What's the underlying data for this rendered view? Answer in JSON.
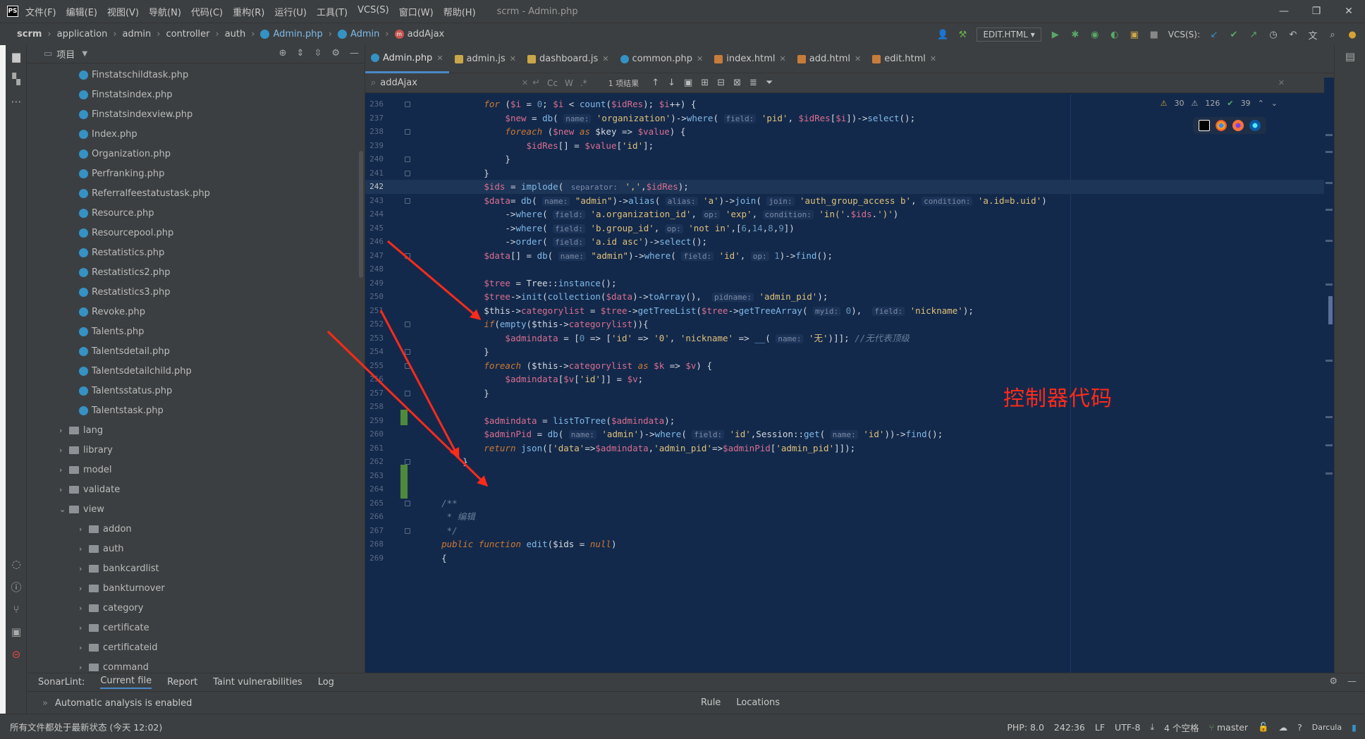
{
  "window": {
    "app_logo": "PS",
    "title": "scrm - Admin.php",
    "menu": [
      "文件(F)",
      "编辑(E)",
      "视图(V)",
      "导航(N)",
      "代码(C)",
      "重构(R)",
      "运行(U)",
      "工具(T)",
      "VCS(S)",
      "窗口(W)",
      "帮助(H)"
    ],
    "controls": [
      "—",
      "❐",
      "✕"
    ]
  },
  "breadcrumb": [
    "scrm",
    "application",
    "admin",
    "controller",
    "auth",
    "Admin.php",
    "Admin",
    "addAjax"
  ],
  "toolbar": {
    "run_config": "EDIT.HTML",
    "vcs_label": "VCS(S):"
  },
  "project_panel": {
    "title": "项目",
    "tree": [
      {
        "type": "file",
        "label": "Finstatschildtask.php",
        "indent": 3
      },
      {
        "type": "file",
        "label": "Finstatsindex.php",
        "indent": 3
      },
      {
        "type": "file",
        "label": "Finstatsindexview.php",
        "indent": 3
      },
      {
        "type": "file",
        "label": "Index.php",
        "indent": 3
      },
      {
        "type": "file",
        "label": "Organization.php",
        "indent": 3
      },
      {
        "type": "file",
        "label": "Perfranking.php",
        "indent": 3
      },
      {
        "type": "file",
        "label": "Referralfeestatustask.php",
        "indent": 3
      },
      {
        "type": "file",
        "label": "Resource.php",
        "indent": 3
      },
      {
        "type": "file",
        "label": "Resourcepool.php",
        "indent": 3
      },
      {
        "type": "file",
        "label": "Restatistics.php",
        "indent": 3
      },
      {
        "type": "file",
        "label": "Restatistics2.php",
        "indent": 3
      },
      {
        "type": "file",
        "label": "Restatistics3.php",
        "indent": 3
      },
      {
        "type": "file",
        "label": "Revoke.php",
        "indent": 3
      },
      {
        "type": "file",
        "label": "Talents.php",
        "indent": 3
      },
      {
        "type": "file",
        "label": "Talentsdetail.php",
        "indent": 3
      },
      {
        "type": "file",
        "label": "Talentsdetailchild.php",
        "indent": 3
      },
      {
        "type": "file",
        "label": "Talentsstatus.php",
        "indent": 3
      },
      {
        "type": "file",
        "label": "Talentstask.php",
        "indent": 3
      },
      {
        "type": "folder",
        "label": "lang",
        "indent": 2,
        "open": false
      },
      {
        "type": "folder",
        "label": "library",
        "indent": 2,
        "open": false
      },
      {
        "type": "folder",
        "label": "model",
        "indent": 2,
        "open": false
      },
      {
        "type": "folder",
        "label": "validate",
        "indent": 2,
        "open": false
      },
      {
        "type": "folder",
        "label": "view",
        "indent": 2,
        "open": true
      },
      {
        "type": "folder",
        "label": "addon",
        "indent": 3,
        "open": false
      },
      {
        "type": "folder",
        "label": "auth",
        "indent": 3,
        "open": false
      },
      {
        "type": "folder",
        "label": "bankcardlist",
        "indent": 3,
        "open": false
      },
      {
        "type": "folder",
        "label": "bankturnover",
        "indent": 3,
        "open": false
      },
      {
        "type": "folder",
        "label": "category",
        "indent": 3,
        "open": false
      },
      {
        "type": "folder",
        "label": "certificate",
        "indent": 3,
        "open": false
      },
      {
        "type": "folder",
        "label": "certificateid",
        "indent": 3,
        "open": false
      },
      {
        "type": "folder",
        "label": "command",
        "indent": 3,
        "open": false
      }
    ]
  },
  "tabs": [
    {
      "label": "Admin.php",
      "kind": "php",
      "active": true
    },
    {
      "label": "admin.js",
      "kind": "js",
      "active": false
    },
    {
      "label": "dashboard.js",
      "kind": "js",
      "active": false
    },
    {
      "label": "common.php",
      "kind": "php",
      "active": false
    },
    {
      "label": "index.html",
      "kind": "html",
      "active": false
    },
    {
      "label": "add.html",
      "kind": "html",
      "active": false
    },
    {
      "label": "edit.html",
      "kind": "html",
      "active": false
    }
  ],
  "find": {
    "query": "addAjax",
    "options": [
      "Cc",
      "W",
      ".*"
    ],
    "result": "1 项结果"
  },
  "inspections": {
    "warnings": "30",
    "weak": "126",
    "ok": "39"
  },
  "current_line": 242,
  "code_lines": [
    {
      "n": 236,
      "html": "            <span class='k'>for</span> (<span class='v'>$i</span> = <span class='n'>0</span>; <span class='v'>$i</span> &lt; <span class='f'>count</span>(<span class='v'>$idRes</span>); <span class='v'>$i</span>++) {"
    },
    {
      "n": 237,
      "html": "                <span class='v'>$new</span> = <span class='f'>db</span>( <span class='h'>name:</span> <span class='s'>'organization'</span>)-&gt;<span class='f'>where</span>( <span class='h'>field:</span> <span class='s'>'pid'</span>, <span class='v'>$idRes</span>[<span class='v'>$i</span>])-&gt;<span class='f'>select</span>();"
    },
    {
      "n": 238,
      "html": "                <span class='k'>foreach</span> (<span class='v'>$new</span> <span class='k'>as</span> $key =&gt; <span class='v'>$value</span>) {"
    },
    {
      "n": 239,
      "html": "                    <span class='v'>$idRes</span>[] = <span class='v'>$value</span>[<span class='s'>'id'</span>];"
    },
    {
      "n": 240,
      "html": "                }"
    },
    {
      "n": 241,
      "html": "            }"
    },
    {
      "n": 242,
      "html": "            <span class='v'>$ids</span> = <span class='f'>implode</span>( <span class='h'>separator:</span> <span class='s'>','</span>,<span class='v'>$idRes</span>);"
    },
    {
      "n": 243,
      "html": "            <span class='v'>$data</span>= <span class='f'>db</span>( <span class='h'>name:</span> <span class='s'>\"admin\"</span>)-&gt;<span class='f'>alias</span>( <span class='h'>alias:</span> <span class='s'>'a'</span>)-&gt;<span class='f'>join</span>( <span class='h'>join:</span> <span class='s'>'auth_group_access b'</span>, <span class='h'>condition:</span> <span class='s'>'a.id=b.uid'</span>)"
    },
    {
      "n": 244,
      "html": "                -&gt;<span class='f'>where</span>( <span class='h'>field:</span> <span class='s'>'a.organization_id'</span>, <span class='h'>op:</span> <span class='s'>'exp'</span>, <span class='h'>condition:</span> <span class='s'>'in('</span>.<span class='v'>$ids</span>.<span class='s'>')'</span>)"
    },
    {
      "n": 245,
      "html": "                -&gt;<span class='f'>where</span>( <span class='h'>field:</span> <span class='s'>'b.group_id'</span>, <span class='h'>op:</span> <span class='s'>'not in'</span>,[<span class='n'>6</span>,<span class='n'>14</span>,<span class='n'>8</span>,<span class='n'>9</span>])"
    },
    {
      "n": 246,
      "html": "                -&gt;<span class='f'>order</span>( <span class='h'>field:</span> <span class='s'>'a.id asc'</span>)-&gt;<span class='f'>select</span>();"
    },
    {
      "n": 247,
      "html": "            <span class='v'>$data</span>[] = <span class='f'>db</span>( <span class='h'>name:</span> <span class='s'>\"admin\"</span>)-&gt;<span class='f'>where</span>( <span class='h'>field:</span> <span class='s'>'id'</span>, <span class='h'>op:</span> <span class='n'>1</span>)-&gt;<span class='f'>find</span>();"
    },
    {
      "n": 248,
      "html": ""
    },
    {
      "n": 249,
      "html": "            <span class='v'>$tree</span> = Tree::<span class='f'>instance</span>();"
    },
    {
      "n": 250,
      "html": "            <span class='v'>$tree</span>-&gt;<span class='f'>init</span>(<span class='f'>collection</span>(<span class='v'>$data</span>)-&gt;<span class='f'>toArray</span>(),  <span class='h'>pidname:</span> <span class='s'>'admin_pid'</span>);"
    },
    {
      "n": 251,
      "html": "            $this-&gt;<span class='v'>categorylist</span> = <span class='v'>$tree</span>-&gt;<span class='f'>getTreeList</span>(<span class='v'>$tree</span>-&gt;<span class='f'>getTreeArray</span>( <span class='h'>myid:</span> <span class='n'>0</span>),  <span class='h'>field:</span> <span class='s'>'nickname'</span>);"
    },
    {
      "n": 252,
      "html": "            <span class='k'>if</span>(<span class='f'>empty</span>($this-&gt;<span class='v'>categorylist</span>)){"
    },
    {
      "n": 253,
      "html": "                <span class='v'>$admindata</span> = [<span class='n'>0</span> =&gt; [<span class='s'>'id'</span> =&gt; <span class='s'>'0'</span>, <span class='s'>'nickname'</span> =&gt; <span class='f'>__</span>( <span class='h'>name:</span> <span class='s'>'无'</span>)]]; <span class='c'>//无代表顶级</span>"
    },
    {
      "n": 254,
      "html": "            }"
    },
    {
      "n": 255,
      "html": "            <span class='k'>foreach</span> ($this-&gt;<span class='v'>categorylist</span> <span class='k'>as</span> <span class='v'>$k</span> =&gt; <span class='v'>$v</span>) {"
    },
    {
      "n": 256,
      "html": "                <span class='v'>$admindata</span>[<span class='v'>$v</span>[<span class='s'>'id'</span>]] = <span class='v'>$v</span>;"
    },
    {
      "n": 257,
      "html": "            }"
    },
    {
      "n": 258,
      "html": ""
    },
    {
      "n": 259,
      "html": "            <span class='v'>$admindata</span> = <span class='f'>listToTree</span>(<span class='v'>$admindata</span>);"
    },
    {
      "n": 260,
      "html": "            <span class='v'>$adminPid</span> = <span class='f'>db</span>( <span class='h'>name:</span> <span class='s'>'admin'</span>)-&gt;<span class='f'>where</span>( <span class='h'>field:</span> <span class='s'>'id'</span>,Session::<span class='f'>get</span>( <span class='h'>name:</span> <span class='s'>'id'</span>))-&gt;<span class='f'>find</span>();"
    },
    {
      "n": 261,
      "html": "            <span class='k'>return</span> <span class='f'>json</span>([<span class='s'>'data'</span>=&gt;<span class='v'>$admindata</span>,<span class='s'>'admin_pid'</span>=&gt;<span class='v'>$adminPid</span>[<span class='s'>'admin_pid'</span>]]);"
    },
    {
      "n": 262,
      "html": "        }"
    },
    {
      "n": 263,
      "html": ""
    },
    {
      "n": 264,
      "html": ""
    },
    {
      "n": 265,
      "html": "    <span class='c'>/**</span>"
    },
    {
      "n": 266,
      "html": "     <span class='c'>* 编辑</span>"
    },
    {
      "n": 267,
      "html": "     <span class='c'>*/</span>"
    },
    {
      "n": 268,
      "html": "    <span class='k'>public function</span> <span class='f'>edit</span>($ids = <span class='k'>null</span>)"
    },
    {
      "n": 269,
      "html": "    {"
    }
  ],
  "annotation": "控制器代码",
  "sonarlint": {
    "title": "SonarLint:",
    "tabs": [
      "Current file",
      "Report",
      "Taint vulnerabilities",
      "Log"
    ],
    "message": "Automatic analysis is enabled",
    "right_tabs": [
      "Rule",
      "Locations"
    ]
  },
  "status": {
    "left": "所有文件都处于最新状态 (今天 12:02)",
    "php": "PHP: 8.0",
    "position": "242:36",
    "line_sep": "LF",
    "encoding": "UTF-8",
    "indent": "4 个空格",
    "branch": "master",
    "theme": "Darcula"
  },
  "colors": {
    "editor_bg": "#13294b",
    "chrome_bg": "#3c3f41",
    "annotation": "#ff2a1a",
    "accent": "#4a88c7"
  }
}
